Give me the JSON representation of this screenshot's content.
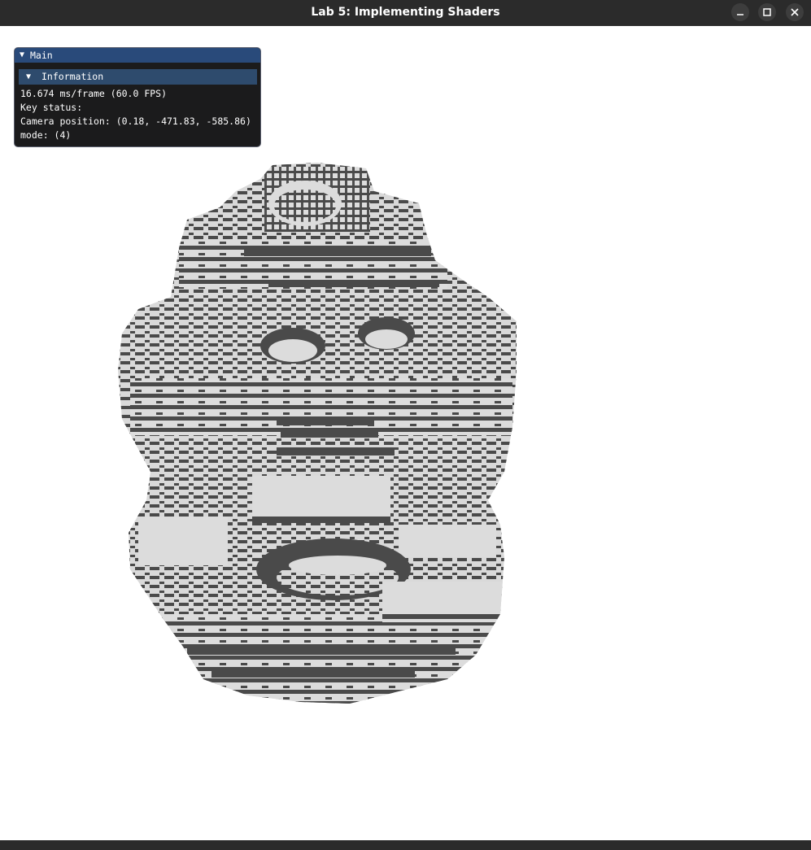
{
  "window": {
    "title": "Lab 5: Implementing Shaders",
    "controls": [
      {
        "name": "minimize",
        "icon": "minimize-icon"
      },
      {
        "name": "maximize",
        "icon": "maximize-icon"
      },
      {
        "name": "close",
        "icon": "close-icon"
      }
    ]
  },
  "imgui": {
    "window_title": "Main",
    "header": "Information",
    "lines": [
      "16.674 ms/frame (60.0 FPS)",
      "Key status:",
      "Camera position: (0.18, -471.83, -585.86)",
      "mode: (4)"
    ],
    "colors": {
      "title_bg": "#294a7a",
      "header_bg": "#2e4b6d",
      "panel_bg": "#1b1b1c"
    }
  },
  "render": {
    "colors": {
      "light_face": "#dcdcdc",
      "dark_face": "#4a4a4a",
      "background": "#ffffff"
    }
  }
}
